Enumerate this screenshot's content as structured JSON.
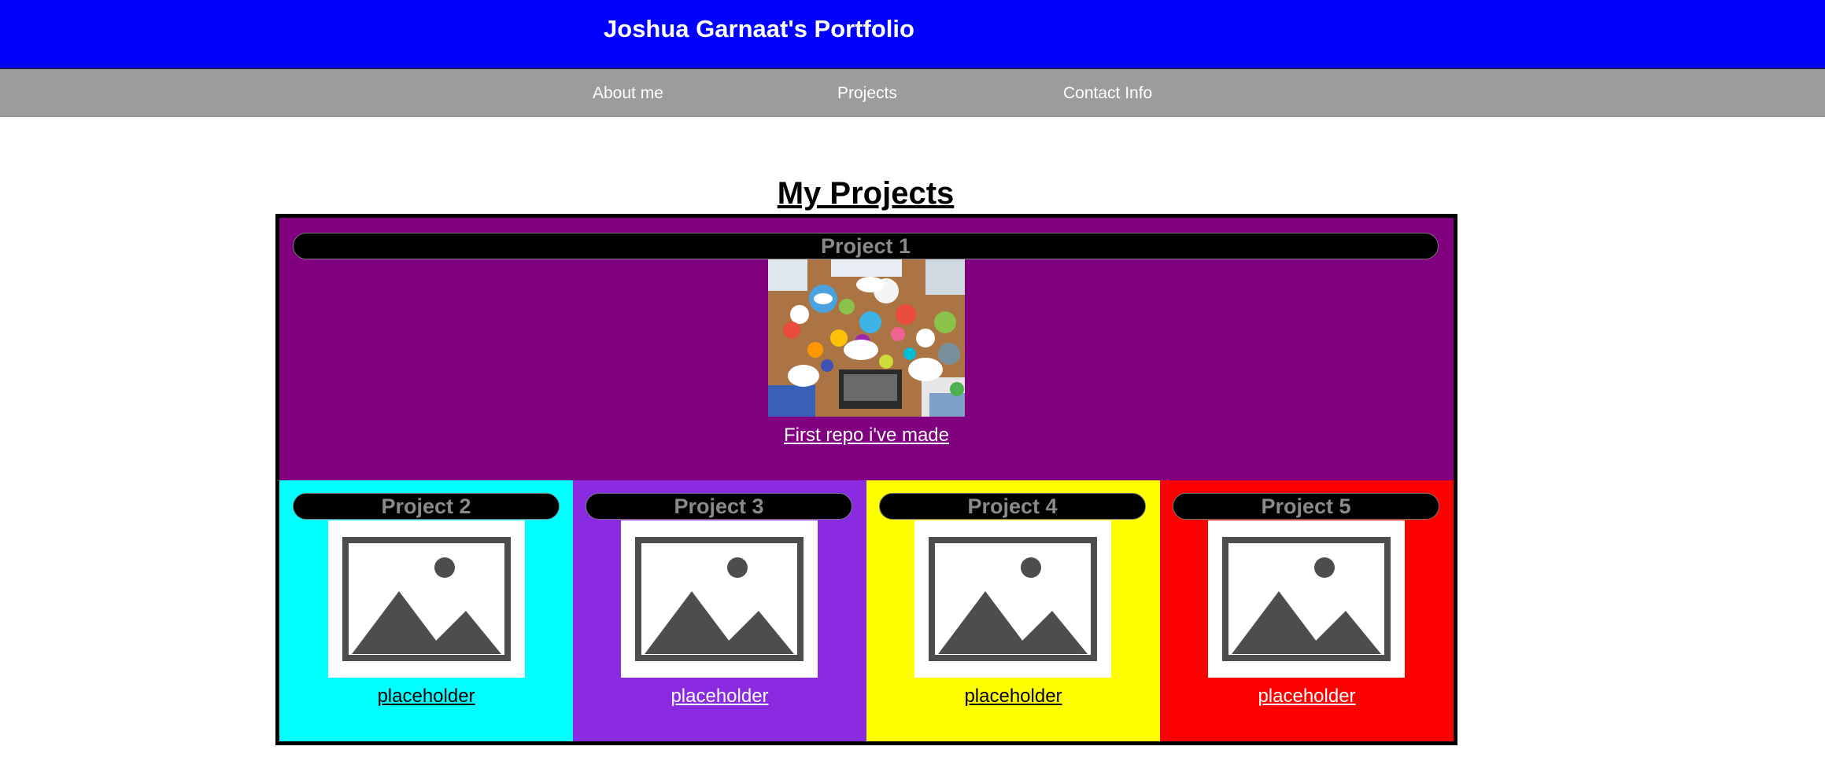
{
  "header": {
    "title": "Joshua Garnaat's Portfolio"
  },
  "nav": {
    "items": [
      {
        "label": "About me"
      },
      {
        "label": "Projects"
      },
      {
        "label": "Contact Info"
      }
    ]
  },
  "main": {
    "heading": "My Projects",
    "featured": {
      "title": "Project 1",
      "link": "First repo i've made",
      "image_icon": "photo-people-social-media-icons",
      "background": "#800080"
    },
    "projects": [
      {
        "title": "Project 2",
        "link": "placeholder",
        "image_icon": "image-placeholder-icon",
        "background": "#00ffff",
        "link_color": "#000000"
      },
      {
        "title": "Project 3",
        "link": "placeholder",
        "image_icon": "image-placeholder-icon",
        "background": "#8a2be2",
        "link_color": "#ffffff"
      },
      {
        "title": "Project 4",
        "link": "placeholder",
        "image_icon": "image-placeholder-icon",
        "background": "#ffff00",
        "link_color": "#000000"
      },
      {
        "title": "Project 5",
        "link": "placeholder",
        "image_icon": "image-placeholder-icon",
        "background": "#ff0000",
        "link_color": "#ffffff"
      }
    ]
  },
  "colors": {
    "header_bg": "#0000ff",
    "nav_bg": "#9c9c9c",
    "pill_bg": "#000000",
    "pill_text": "#8a8a8a"
  }
}
